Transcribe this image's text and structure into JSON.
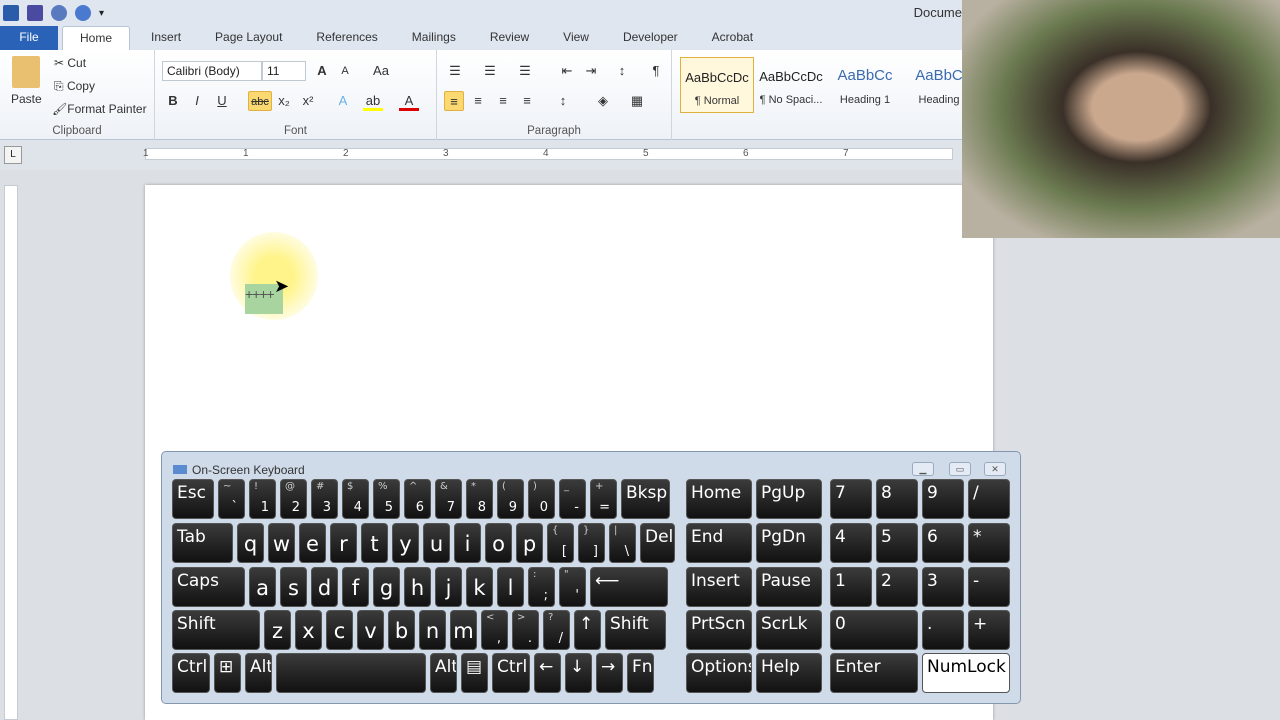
{
  "app": {
    "title": "Docume"
  },
  "tabs": [
    "File",
    "Home",
    "Insert",
    "Page Layout",
    "References",
    "Mailings",
    "Review",
    "View",
    "Developer",
    "Acrobat"
  ],
  "clipboard": {
    "paste": "Paste",
    "cut": "Cut",
    "copy": "Copy",
    "format_painter": "Format Painter",
    "label": "Clipboard"
  },
  "font": {
    "name": "Calibri (Body)",
    "size": "11",
    "label": "Font",
    "bold": "B",
    "italic": "I",
    "underline": "U",
    "strike": "abc",
    "sub": "x₂",
    "sup": "x²"
  },
  "paragraph": {
    "label": "Paragraph",
    "pilcrow": "¶"
  },
  "styles": [
    {
      "preview": "AaBbCcDc",
      "name": "¶ Normal"
    },
    {
      "preview": "AaBbCcDc",
      "name": "¶ No Spaci..."
    },
    {
      "preview": "AaBbCc",
      "name": "Heading 1"
    },
    {
      "preview": "AaBbC",
      "name": "Heading"
    }
  ],
  "ruler": {
    "numbers": [
      "1",
      "1",
      "2",
      "3",
      "4",
      "5",
      "6",
      "7"
    ]
  },
  "document": {
    "selected_text": "++++"
  },
  "osk": {
    "title": "On-Screen Keyboard",
    "main_rows": [
      [
        [
          "Esc",
          ""
        ],
        [
          "`",
          "~"
        ],
        [
          "1",
          "!"
        ],
        [
          "2",
          "@"
        ],
        [
          "3",
          "#"
        ],
        [
          "4",
          "$"
        ],
        [
          "5",
          "%"
        ],
        [
          "6",
          "^"
        ],
        [
          "7",
          "&"
        ],
        [
          "8",
          "*"
        ],
        [
          "9",
          "("
        ],
        [
          "0",
          ")"
        ],
        [
          "-",
          "_"
        ],
        [
          "=",
          "+"
        ],
        [
          "Bksp",
          ""
        ]
      ],
      [
        [
          "Tab",
          ""
        ],
        [
          "q",
          ""
        ],
        [
          "w",
          ""
        ],
        [
          "e",
          ""
        ],
        [
          "r",
          ""
        ],
        [
          "t",
          ""
        ],
        [
          "y",
          ""
        ],
        [
          "u",
          ""
        ],
        [
          "i",
          ""
        ],
        [
          "o",
          ""
        ],
        [
          "p",
          ""
        ],
        [
          "[",
          "{"
        ],
        [
          "]",
          "}"
        ],
        [
          "\\",
          "|"
        ],
        [
          "Del",
          ""
        ]
      ],
      [
        [
          "Caps",
          ""
        ],
        [
          "a",
          ""
        ],
        [
          "s",
          ""
        ],
        [
          "d",
          ""
        ],
        [
          "f",
          ""
        ],
        [
          "g",
          ""
        ],
        [
          "h",
          ""
        ],
        [
          "j",
          ""
        ],
        [
          "k",
          ""
        ],
        [
          "l",
          ""
        ],
        [
          ";",
          ":"
        ],
        [
          "'",
          "\""
        ],
        [
          "⟵",
          ""
        ]
      ],
      [
        [
          "Shift",
          ""
        ],
        [
          "z",
          ""
        ],
        [
          "x",
          ""
        ],
        [
          "c",
          ""
        ],
        [
          "v",
          ""
        ],
        [
          "b",
          ""
        ],
        [
          "n",
          ""
        ],
        [
          "m",
          ""
        ],
        [
          ",",
          "<"
        ],
        [
          ".",
          ">"
        ],
        [
          "/",
          "?"
        ],
        [
          "↑",
          ""
        ],
        [
          "Shift",
          ""
        ]
      ],
      [
        [
          "Ctrl",
          ""
        ],
        [
          "⊞",
          ""
        ],
        [
          "Alt",
          ""
        ],
        [
          "",
          ""
        ],
        [
          "Alt",
          ""
        ],
        [
          "▤",
          ""
        ],
        [
          "Ctrl",
          ""
        ],
        [
          "←",
          ""
        ],
        [
          "↓",
          ""
        ],
        [
          "→",
          ""
        ],
        [
          "Fn",
          ""
        ]
      ]
    ],
    "nav_rows": [
      [
        "Home",
        "PgUp"
      ],
      [
        "End",
        "PgDn"
      ],
      [
        "Insert",
        "Pause"
      ],
      [
        "PrtScn",
        "ScrLk"
      ],
      [
        "Options",
        "Help"
      ]
    ],
    "numpad_rows": [
      [
        "7",
        "8",
        "9",
        "/"
      ],
      [
        "4",
        "5",
        "6",
        "*"
      ],
      [
        "1",
        "2",
        "3",
        "-"
      ],
      [
        "0",
        ".",
        "+"
      ],
      [
        "Enter",
        "NumLock"
      ]
    ],
    "active_key": "NumLock"
  }
}
